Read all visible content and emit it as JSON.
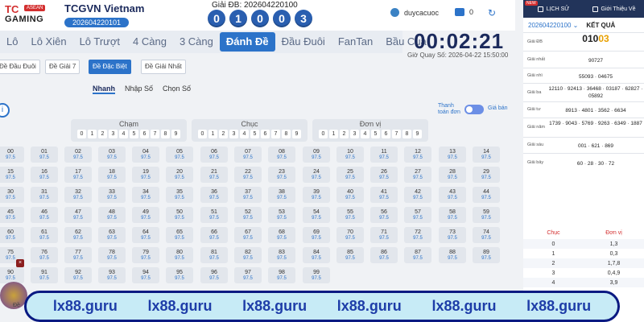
{
  "header": {
    "logo_tc": "TC",
    "logo_asean": "ASEAN",
    "logo_gaming": "GAMING",
    "brand_name": "TCGVN Vietnam",
    "brand_id": "202604220101",
    "draw_label": "Giải ĐB: 202604220100",
    "draw_balls": [
      "0",
      "1",
      "0",
      "0",
      "3"
    ],
    "username": "duycacuoc",
    "balance": "0"
  },
  "nav": {
    "items": [
      "Lô",
      "Lô Xiên",
      "Lô Trượt",
      "4 Càng",
      "3 Càng",
      "Đánh Đề",
      "Đầu Đuôi",
      "FanTan",
      "Bầu Cua"
    ],
    "active_index": 5
  },
  "timer": {
    "value": "00:02:21",
    "sub": "Giờ Quay Số: 2026-04-22 15:50:00"
  },
  "subtabs": {
    "items": [
      "Đề Đầu Đuôi",
      "Đề Giải 7",
      "Đề Đặc Biệt",
      "Đề Giải Nhất"
    ],
    "active_index": 2
  },
  "modes": {
    "items": [
      "Nhanh",
      "Nhập Số",
      "Chọn Số"
    ],
    "active_index": 0
  },
  "options": {
    "pay_label": "Thanh toán đơn",
    "price_label": "Giá bán"
  },
  "groups": [
    {
      "title": "Chạm",
      "digits": [
        "0",
        "1",
        "2",
        "3",
        "4",
        "5",
        "6",
        "7",
        "8",
        "9"
      ]
    },
    {
      "title": "Chục",
      "digits": [
        "0",
        "1",
        "2",
        "3",
        "4",
        "5",
        "6",
        "7",
        "8",
        "9"
      ]
    },
    {
      "title": "Đơn vị",
      "digits": [
        "0",
        "1",
        "2",
        "3",
        "4",
        "5",
        "6",
        "7",
        "8",
        "9"
      ]
    }
  ],
  "grid": {
    "odds": "97.5",
    "numbers": [
      "00",
      "01",
      "02",
      "03",
      "04",
      "05",
      "06",
      "07",
      "08",
      "09",
      "10",
      "11",
      "12",
      "13",
      "14",
      "15",
      "16",
      "17",
      "18",
      "19",
      "20",
      "21",
      "22",
      "23",
      "24",
      "25",
      "26",
      "27",
      "28",
      "29",
      "30",
      "31",
      "32",
      "33",
      "34",
      "35",
      "36",
      "37",
      "38",
      "39",
      "40",
      "41",
      "42",
      "43",
      "44",
      "45",
      "46",
      "47",
      "48",
      "49",
      "50",
      "51",
      "52",
      "53",
      "54",
      "55",
      "56",
      "57",
      "58",
      "59",
      "60",
      "61",
      "62",
      "63",
      "64",
      "65",
      "66",
      "67",
      "68",
      "69",
      "70",
      "71",
      "72",
      "73",
      "74",
      "75",
      "76",
      "77",
      "78",
      "79",
      "80",
      "81",
      "82",
      "83",
      "84",
      "85",
      "86",
      "87",
      "88",
      "89",
      "90",
      "91",
      "92",
      "93",
      "94",
      "95",
      "96",
      "97",
      "98",
      "99"
    ]
  },
  "right_panel": {
    "new_badge": "NEW",
    "tab_history": "LỊCH SỬ",
    "tab_intro": "Giới Thiệu Về",
    "selected_draw": "202604220100 ⌄",
    "result_label": "KẾT QUẢ",
    "results": [
      {
        "label": "Giải ĐB",
        "value_main": "010",
        "value_hl": "03"
      },
      {
        "label": "Giải nhất",
        "value": "90727"
      },
      {
        "label": "Giải nhì",
        "value": "55093 · 04675"
      },
      {
        "label": "Giải ba",
        "value": "12110 · 92413 · 36468 · 03187 · 62827 · 05892"
      },
      {
        "label": "Giải tư",
        "value": "8913 · 4801 · 3562 · 6634"
      },
      {
        "label": "Giải năm",
        "value": "1739 · 9043 · 5769 · 9263 · 6349 · 1887"
      },
      {
        "label": "Giải sáu",
        "value": "001 · 621 · 869"
      },
      {
        "label": "Giải bảy",
        "value": "60 · 28 · 30 · 72"
      }
    ],
    "stats_headers": [
      "Chục",
      "Đơn vị"
    ],
    "stats": [
      [
        "0",
        "1,3"
      ],
      [
        "1",
        "0,3"
      ],
      [
        "2",
        "1,7,8"
      ],
      [
        "3",
        "0,4,9"
      ],
      [
        "4",
        "3,9"
      ]
    ]
  },
  "banner": {
    "text": "lx88.guru",
    "repeat": 6
  },
  "side": {
    "text": "Đề"
  }
}
